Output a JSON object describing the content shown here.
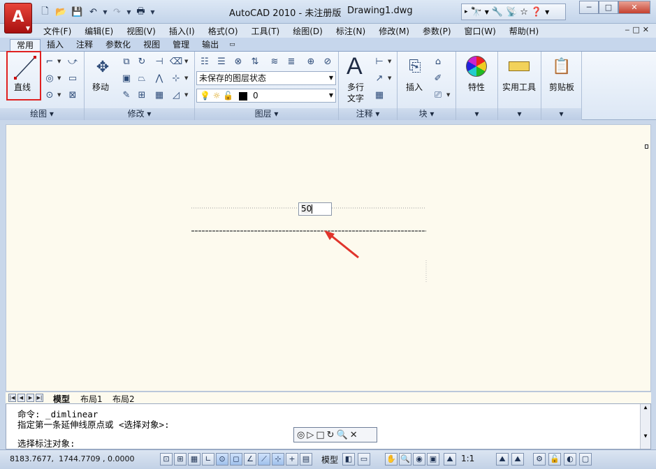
{
  "window": {
    "title": "AutoCAD 2010 - 未注册版",
    "document": "Drawing1.dwg",
    "controls": [
      "─",
      "□",
      "✕"
    ]
  },
  "app_logo": "A",
  "quick_access": [
    "new-icon",
    "open-icon",
    "save-icon",
    "undo-icon",
    "redo-icon",
    "plot-icon"
  ],
  "menu": [
    "文件(F)",
    "编辑(E)",
    "视图(V)",
    "插入(I)",
    "格式(O)",
    "工具(T)",
    "绘图(D)",
    "标注(N)",
    "修改(M)",
    "参数(P)",
    "窗口(W)",
    "帮助(H)"
  ],
  "ribbon_tabs": [
    "常用",
    "插入",
    "注释",
    "参数化",
    "视图",
    "管理",
    "输出"
  ],
  "ribbon_tabs_more": "▭",
  "panels": {
    "draw": {
      "title": "绘图 ▾",
      "big_label": "直线"
    },
    "modify": {
      "title": "修改 ▾",
      "big_label": "移动"
    },
    "layers": {
      "title": "图层 ▾",
      "layer_state": "未保存的图层状态",
      "current_layer": "0"
    },
    "annotation": {
      "title": "注释 ▾",
      "big_label_1": "多行",
      "big_label_2": "文字"
    },
    "block": {
      "title": "块 ▾",
      "big_label": "插入"
    },
    "properties": {
      "big_label": "特性"
    },
    "utilities": {
      "big_label": "实用工具"
    },
    "clipboard": {
      "big_label": "剪贴板"
    }
  },
  "drawing": {
    "dimension_input": "50"
  },
  "layout_tabs": [
    "模型",
    "布局1",
    "布局2"
  ],
  "command_line": {
    "line1": "命令: _dimlinear",
    "line2": "指定第一条延伸线原点或 <选择对象>:",
    "line3": "选择标注对象:"
  },
  "status": {
    "coords": "8183.7677,  1744.7709 , 0.0000",
    "model": "模型",
    "scale": "1:1"
  },
  "colors": {
    "highlight": "#e02020",
    "canvas": "#fdfaee",
    "arrow": "#e0342b"
  }
}
